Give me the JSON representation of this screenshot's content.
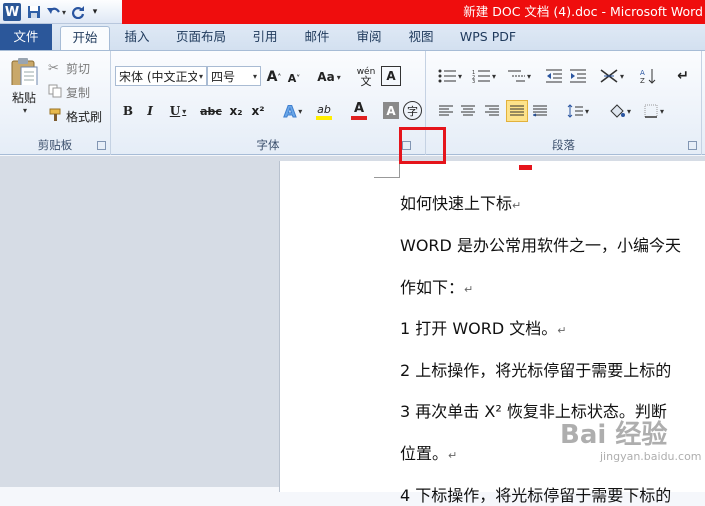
{
  "window": {
    "title": "新建 DOC 文档 (4).doc - Microsoft Word"
  },
  "tabs": [
    "文件",
    "开始",
    "插入",
    "页面布局",
    "引用",
    "邮件",
    "审阅",
    "视图",
    "WPS PDF"
  ],
  "clipboard": {
    "paste": "粘贴",
    "cut": "剪切",
    "copy": "复制",
    "painter": "格式刷",
    "label": "剪贴板"
  },
  "font": {
    "name": "宋体 (中文正文",
    "size": "四号",
    "label": "字体",
    "bold": "B",
    "italic": "I",
    "underline": "U",
    "strike": "abc",
    "sub": "x₂",
    "sup": "x²",
    "grow": "A",
    "shrink": "A",
    "case": "Aa",
    "wen": "wén",
    "wenchar": "文",
    "clear": "A",
    "highlight": "ab",
    "fontcolor": "A",
    "shade": "A",
    "circle": "字"
  },
  "paragraph": {
    "label": "段落"
  },
  "colors": {
    "accent": "#2b579a",
    "title_bar": "#ef0d0d",
    "highlight_box": "#e5141b",
    "font_color_bar": "#e02020",
    "highlight_bar": "#ffee00"
  },
  "document": {
    "lines": [
      "如何快速上下标",
      "WORD 是办公常用软件之一，小编今天",
      "作如下：",
      "1 打开 WORD 文档。",
      "2 上标操作，将光标停留于需要上标的",
      "3 再次单击 X² 恢复非上标状态。判断",
      "位置。",
      "4 下标操作，将光标停留于需要下标的"
    ]
  },
  "watermark": {
    "brand": "Bai 经验",
    "url": "jingyan.baidu.com"
  }
}
